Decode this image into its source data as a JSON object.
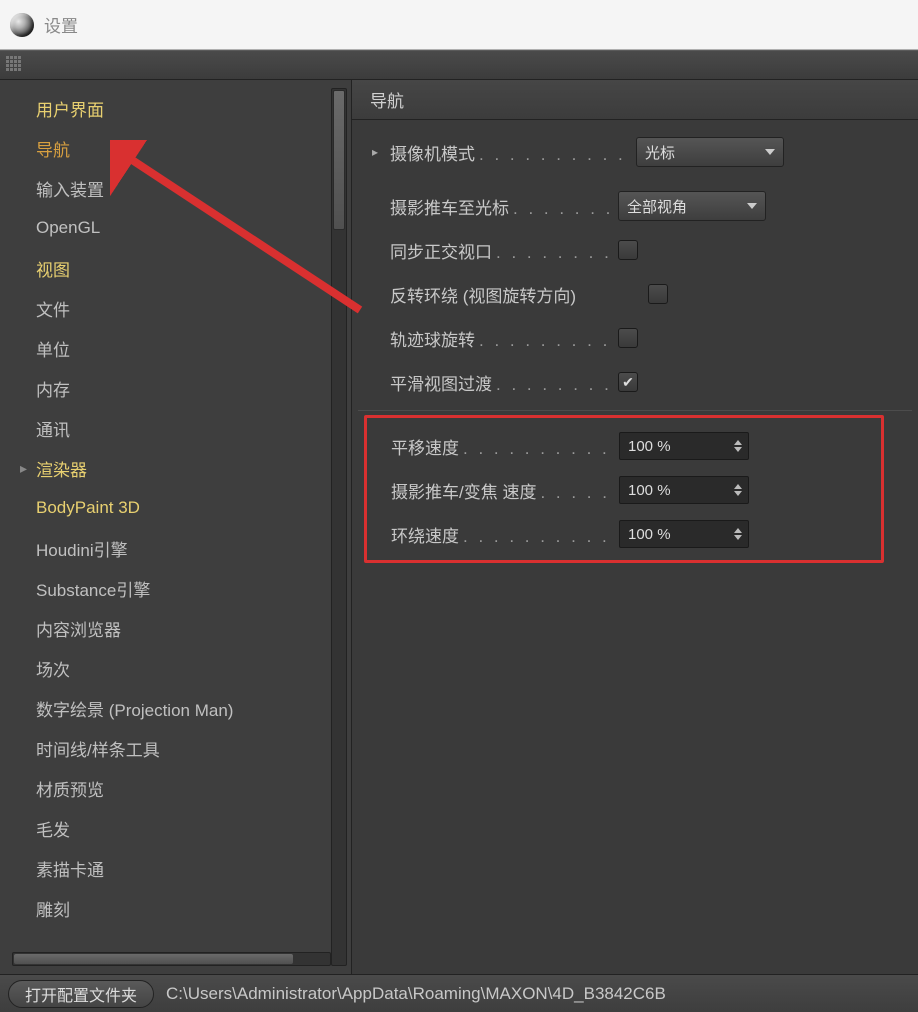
{
  "window": {
    "title": "设置"
  },
  "sidebar": {
    "items": [
      {
        "label": "用户界面",
        "highlight": true
      },
      {
        "label": "导航",
        "selected": true
      },
      {
        "label": "输入装置"
      },
      {
        "label": "OpenGL"
      },
      {
        "label": "视图",
        "highlight": true
      },
      {
        "label": "文件"
      },
      {
        "label": "单位"
      },
      {
        "label": "内存"
      },
      {
        "label": "通讯"
      },
      {
        "label": "渲染器",
        "highlight": true,
        "expander": true
      },
      {
        "label": "BodyPaint 3D",
        "highlight": true
      },
      {
        "label": "Houdini引擎"
      },
      {
        "label": "Substance引擎"
      },
      {
        "label": "内容浏览器"
      },
      {
        "label": "场次"
      },
      {
        "label": "数字绘景 (Projection Man)"
      },
      {
        "label": "时间线/样条工具"
      },
      {
        "label": "材质预览"
      },
      {
        "label": "毛发"
      },
      {
        "label": "素描卡通"
      },
      {
        "label": "雕刻"
      }
    ]
  },
  "panel": {
    "title": "导航",
    "rows": {
      "camera_mode": {
        "label": "摄像机模式",
        "value": "光标",
        "type": "dropdown",
        "expander": true
      },
      "dolly_to_cursor": {
        "label": "摄影推车至光标",
        "value": "全部视角",
        "type": "dropdown"
      },
      "sync_ortho": {
        "label": "同步正交视口",
        "value": false,
        "type": "checkbox"
      },
      "reverse_orbit": {
        "label": "反转环绕 (视图旋转方向)",
        "value": false,
        "type": "checkbox"
      },
      "trackball": {
        "label": "轨迹球旋转",
        "value": false,
        "type": "checkbox"
      },
      "smooth_transition": {
        "label": "平滑视图过渡",
        "value": true,
        "type": "checkbox"
      },
      "pan_speed": {
        "label": "平移速度",
        "value": "100 %",
        "type": "spinner"
      },
      "dolly_zoom_speed": {
        "label": "摄影推车/变焦 速度",
        "value": "100 %",
        "type": "spinner"
      },
      "orbit_speed": {
        "label": "环绕速度",
        "value": "100 %",
        "type": "spinner"
      }
    }
  },
  "footer": {
    "button": "打开配置文件夹",
    "path": "C:\\Users\\Administrator\\AppData\\Roaming\\MAXON\\4D_B3842C6B"
  }
}
